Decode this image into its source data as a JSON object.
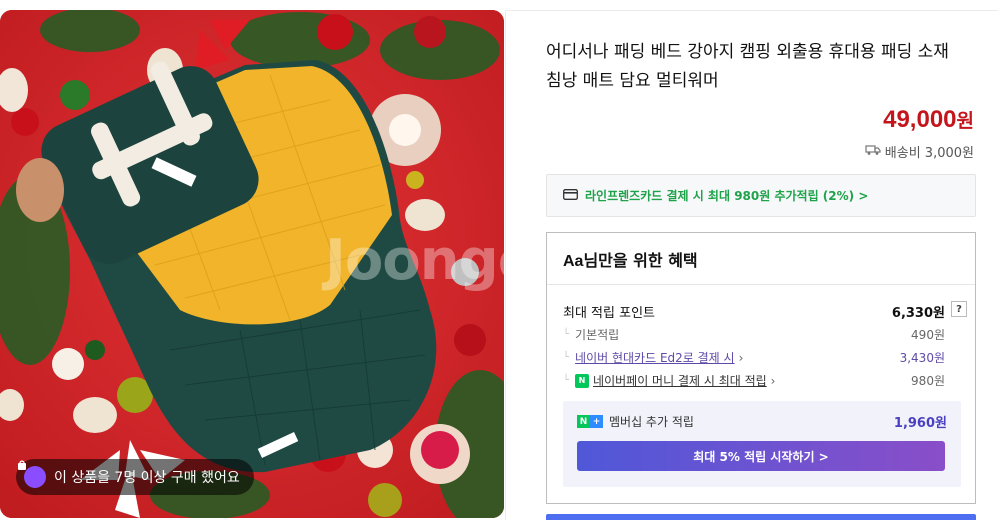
{
  "product": {
    "title": "어디서나 패딩 베드 강아지 캠핑 외출용 휴대용 패딩 소재 침낭 매트 담요 멀티워머",
    "image_watermark": "Joongo",
    "buyers_badge": "이 상품을 7명 이상 구매 했어요"
  },
  "price": {
    "amount": "49,000",
    "unit": "원",
    "shipping": "배송비 3,000원"
  },
  "card_promo": {
    "text": "라인프렌즈카드 결제 시 최대 980원 추가적립 (2%) >"
  },
  "benefits": {
    "user": "Aa",
    "title_suffix": "님만을 위한 혜택",
    "max_points_label": "최대 적립 포인트",
    "max_points_value": "6,330원",
    "help_icon": "?",
    "rows": [
      {
        "label": "기본적립",
        "value": "490원"
      },
      {
        "label": "네이버 현대카드 Ed2로 결제 시",
        "value": "3,430원"
      },
      {
        "label": "네이버페이 머니 결제 시 최대 적립",
        "value": "980원"
      }
    ],
    "membership": {
      "label": "멤버십 추가 적립",
      "value": "1,960원",
      "button": "최대 5% 적립 시작하기 >"
    }
  },
  "colors": {
    "price": "#c4151c",
    "promo": "#1fa34a",
    "accent": "#5e4aa8"
  },
  "icons": [
    "bag-icon",
    "truck-icon",
    "card-icon",
    "npay-icon",
    "naver-plus-icon",
    "question-icon",
    "chevron-right-icon"
  ]
}
